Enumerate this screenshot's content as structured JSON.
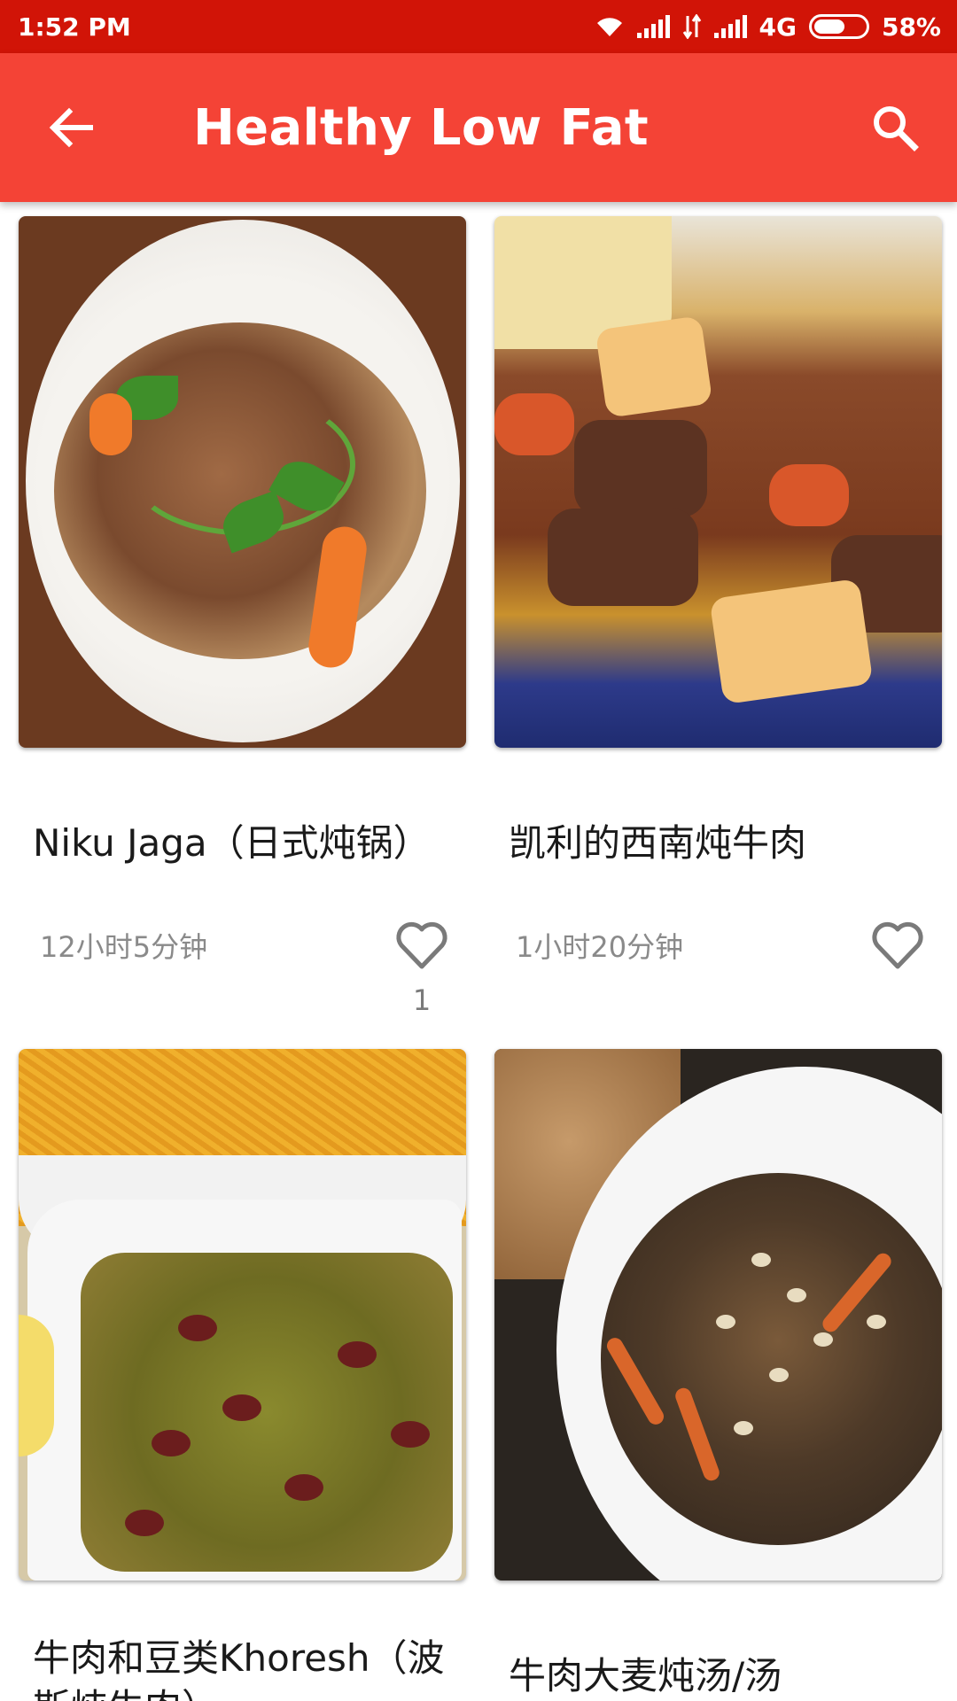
{
  "status_bar": {
    "time": "1:52 PM",
    "network": "4G",
    "battery": "58%",
    "battery_level": 0.58
  },
  "toolbar": {
    "title": "Healthy Low Fat",
    "back_icon": "arrow-left-icon",
    "search_icon": "search-icon"
  },
  "colors": {
    "status_bar": "#d11407",
    "app_bar": "#f44336"
  },
  "recipes": [
    {
      "title": "Niku Jaga（日式炖锅）",
      "time": "12小时5分钟",
      "likes": "1",
      "image": "beef-stew-white-bowl"
    },
    {
      "title": "凯利的西南炖牛肉",
      "time": "1小时20分钟",
      "likes": "",
      "image": "southwestern-beef-stew"
    },
    {
      "title": "牛肉和豆类Khoresh（波斯炖牛肉）",
      "time": "",
      "likes": "",
      "image": "persian-beef-bean-stew"
    },
    {
      "title": "牛肉大麦炖汤/汤",
      "time": "",
      "likes": "",
      "image": "beef-barley-soup"
    }
  ]
}
